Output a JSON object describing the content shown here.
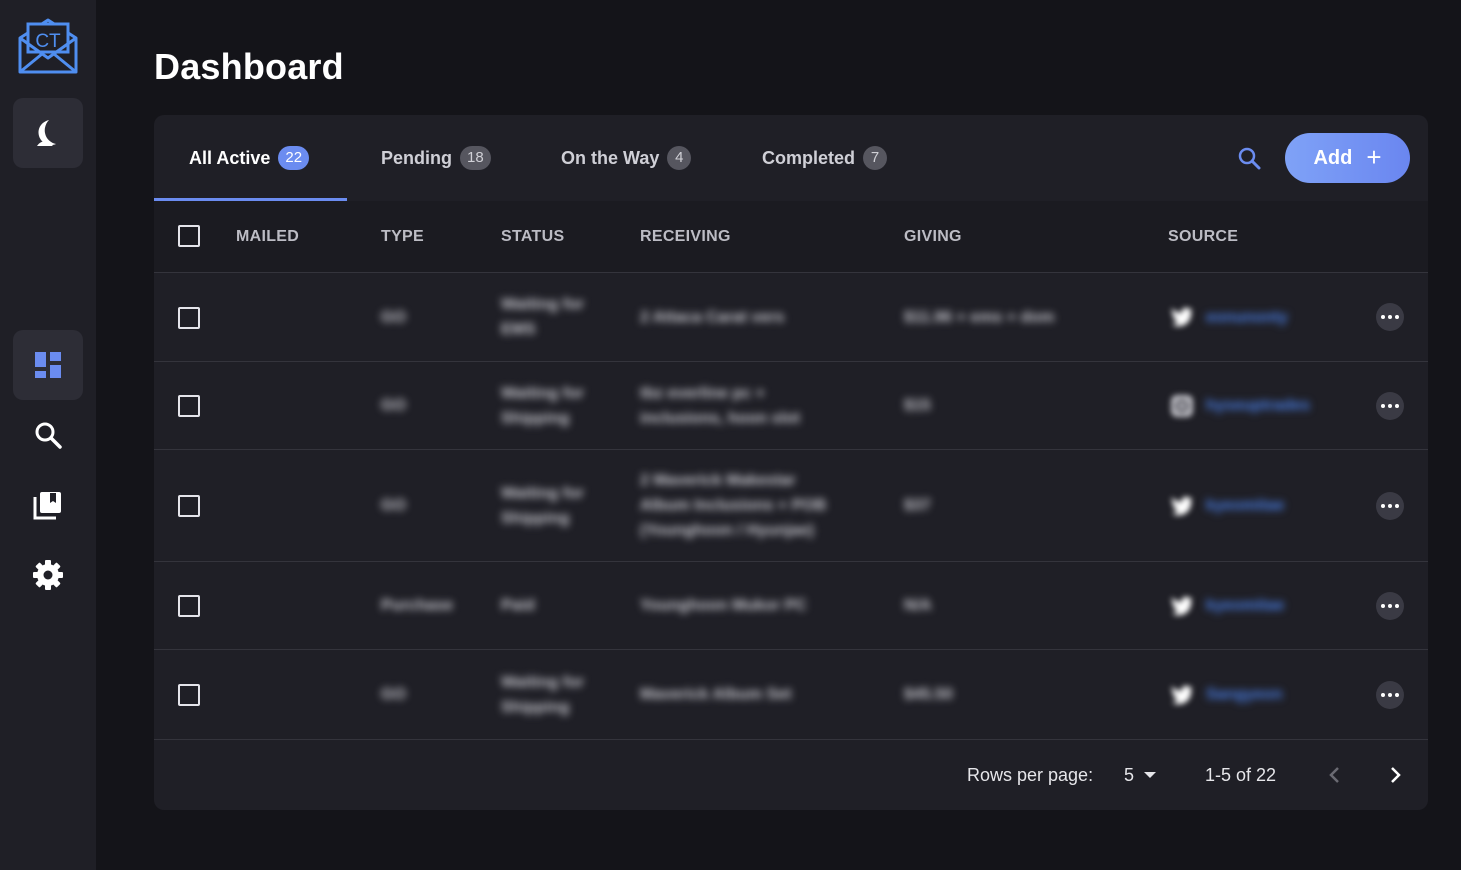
{
  "app": {
    "logo_text": "CT"
  },
  "sidebar": {
    "items": [
      {
        "name": "theme-toggle",
        "icon": "moon-icon"
      },
      {
        "name": "dashboard",
        "icon": "dashboard-icon",
        "active": true
      },
      {
        "name": "search",
        "icon": "search-icon"
      },
      {
        "name": "collection",
        "icon": "library-icon"
      },
      {
        "name": "settings",
        "icon": "gear-icon"
      }
    ]
  },
  "page": {
    "title": "Dashboard"
  },
  "tabs": [
    {
      "label": "All Active",
      "count": "22",
      "active": true
    },
    {
      "label": "Pending",
      "count": "18",
      "active": false
    },
    {
      "label": "On the Way",
      "count": "4",
      "active": false
    },
    {
      "label": "Completed",
      "count": "7",
      "active": false
    }
  ],
  "toolbar": {
    "add_label": "Add",
    "search_icon": "search-icon",
    "accent_color": "#6b8cf0"
  },
  "table": {
    "columns": [
      "MAILED",
      "TYPE",
      "STATUS",
      "RECEIVING",
      "GIVING",
      "SOURCE"
    ],
    "rows": [
      {
        "type": "GO",
        "status": [
          "Waiting for",
          "EMS"
        ],
        "receiving": [
          "2 Attaca Carat vers"
        ],
        "giving": "$11.96 + ems + dom",
        "source_icon": "twitter-icon",
        "source": "eonunonty"
      },
      {
        "type": "GO",
        "status": [
          "Waiting for",
          "Shipping"
        ],
        "receiving": [
          "tbz everline pc +",
          "inclusions, hoon slot"
        ],
        "giving": "$15",
        "source_icon": "instagram-icon",
        "source": "hyseuptrades"
      },
      {
        "type": "GO",
        "status": [
          "Waiting for",
          "Shipping"
        ],
        "receiving": [
          "2 Maverick Makestar",
          "Album Inclusions + POB",
          "(Younghoon / Hyunjae)"
        ],
        "giving": "$37",
        "source_icon": "twitter-icon",
        "source": "kyeomitae"
      },
      {
        "type": "Purchase",
        "status": [
          "Paid"
        ],
        "receiving": [
          "Younghoon Mukor PC"
        ],
        "giving": "N/A",
        "source_icon": "twitter-icon",
        "source": "kyeomitae"
      },
      {
        "type": "GO",
        "status": [
          "Waiting for",
          "Shipping"
        ],
        "receiving": [
          "Maverick Album Set"
        ],
        "giving": "$45.50",
        "source_icon": "twitter-icon",
        "source": "Sangyeon"
      }
    ]
  },
  "pagination": {
    "rows_per_page_label": "Rows per page:",
    "rows_per_page_value": "5",
    "range_text": "1-5 of 22"
  }
}
